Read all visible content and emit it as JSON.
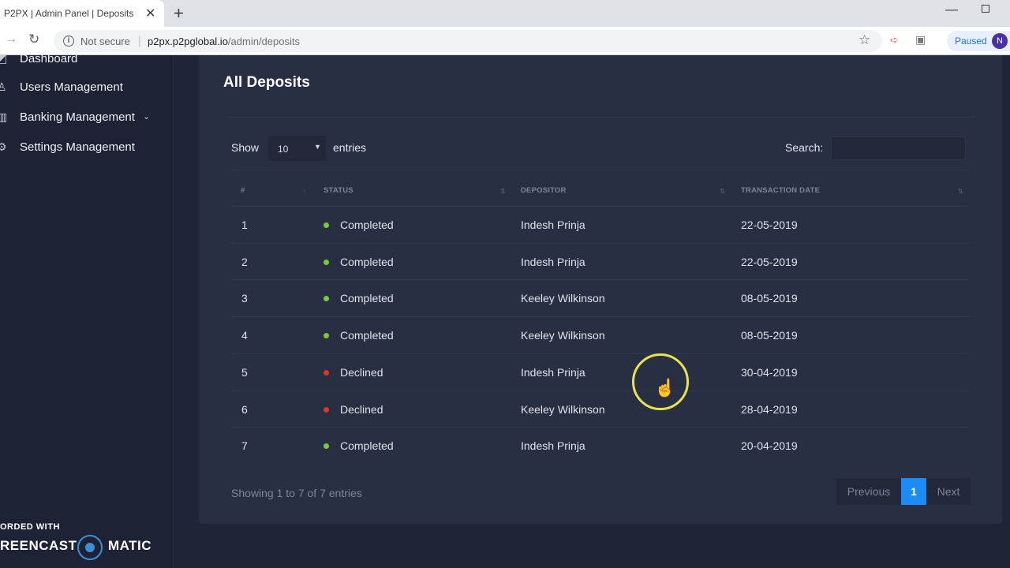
{
  "browser": {
    "tab_title": "P2PX | Admin Panel | Deposits",
    "tab_close": "✕",
    "new_tab": "+",
    "minimize": "—",
    "not_secure": "Not secure",
    "url_host": "p2px.p2pglobal.io",
    "url_path": "/admin/deposits",
    "profile_status": "Paused",
    "avatar_letter": "N"
  },
  "sidebar": {
    "items": [
      {
        "label": "Dashboard",
        "icon": "dashboard-icon"
      },
      {
        "label": "Users Management",
        "icon": "users-icon"
      },
      {
        "label": "Banking Management",
        "icon": "bank-icon",
        "has_submenu": true
      },
      {
        "label": "Settings Management",
        "icon": "gear-icon"
      }
    ]
  },
  "watermark": {
    "top": "ORDED WITH",
    "left": "REENCAST",
    "right": "MATIC"
  },
  "page": {
    "title": "All Deposits",
    "show_label": "Show",
    "page_size": "10",
    "entries_label": "entries",
    "search_label": "Search:",
    "search_value": ""
  },
  "table": {
    "headers": [
      "#",
      "Status",
      "Depositor",
      "Transaction Date"
    ],
    "rows": [
      {
        "num": "1",
        "status": "Completed",
        "depositor": "Indesh Prinja",
        "date": "22-05-2019"
      },
      {
        "num": "2",
        "status": "Completed",
        "depositor": "Indesh Prinja",
        "date": "22-05-2019"
      },
      {
        "num": "3",
        "status": "Completed",
        "depositor": "Keeley Wilkinson",
        "date": "08-05-2019"
      },
      {
        "num": "4",
        "status": "Completed",
        "depositor": "Keeley Wilkinson",
        "date": "08-05-2019"
      },
      {
        "num": "5",
        "status": "Declined",
        "depositor": "Indesh Prinja",
        "date": "30-04-2019"
      },
      {
        "num": "6",
        "status": "Declined",
        "depositor": "Keeley Wilkinson",
        "date": "28-04-2019"
      },
      {
        "num": "7",
        "status": "Completed",
        "depositor": "Indesh Prinja",
        "date": "20-04-2019"
      }
    ]
  },
  "footer": {
    "info": "Showing 1 to 7 of 7 entries",
    "previous": "Previous",
    "current_page": "1",
    "next": "Next"
  },
  "colors": {
    "completed": "#7cc63a",
    "declined": "#e0332f",
    "accent": "#1b8bf7"
  }
}
